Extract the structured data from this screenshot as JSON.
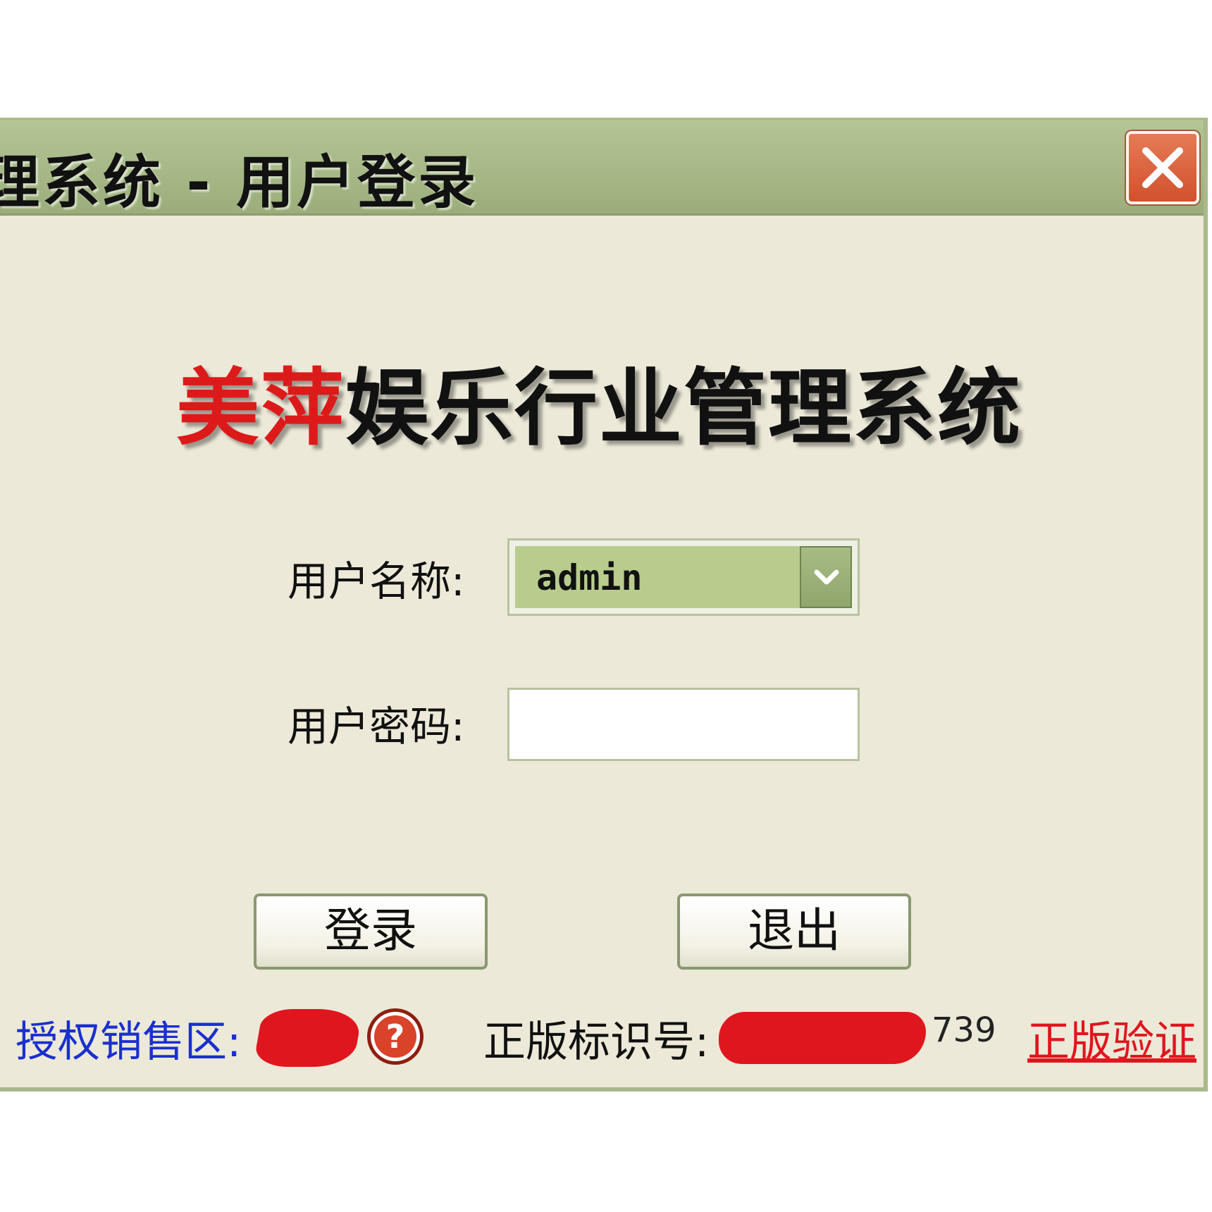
{
  "window": {
    "title": "理系统 - 用户登录",
    "close_label": "close"
  },
  "banner": {
    "red_part": "美萍",
    "black_part": "娱乐行业管理系统"
  },
  "form": {
    "username_label": "用户名称:",
    "username_value": "admin",
    "password_label": "用户密码:",
    "password_value": ""
  },
  "buttons": {
    "login": "登录",
    "exit": "退出"
  },
  "footer": {
    "sales_area_label": "授权销售区:",
    "serial_label": "正版标识号:",
    "serial_suffix": "739",
    "verify_link": "正版验证"
  },
  "colors": {
    "titlebar": "#a9b98a",
    "window_bg": "#ece9d8",
    "brand_red": "#dd1a1a",
    "link_blue": "#1a2fd0",
    "verify_red": "#e0161e"
  },
  "icons": {
    "close": "close-x-icon",
    "dropdown": "chevron-down-icon",
    "help": "question-help-icon"
  }
}
